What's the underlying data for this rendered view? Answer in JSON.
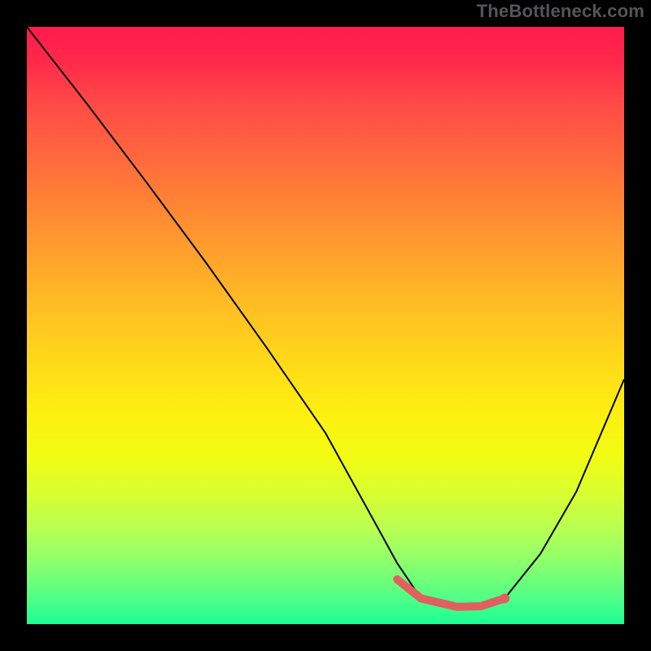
{
  "watermark": "TheBottleneck.com",
  "chart_data": {
    "type": "line",
    "title": "",
    "xlabel": "",
    "ylabel": "",
    "xlim": [
      0,
      100
    ],
    "ylim": [
      0,
      100
    ],
    "grid": false,
    "legend": false,
    "series": [
      {
        "name": "bottleneck-curve",
        "x": [
          0,
          10,
          20,
          30,
          40,
          50,
          58,
          62,
          66,
          72,
          76,
          80,
          86,
          92,
          100
        ],
        "values": [
          100,
          87.2,
          74.0,
          60.5,
          46.5,
          32.0,
          17.5,
          10.2,
          4.3,
          2.9,
          3.0,
          4.3,
          11.8,
          22.2,
          41.0
        ]
      },
      {
        "name": "highlight-band",
        "x": [
          62,
          66,
          72,
          76,
          80
        ],
        "values": [
          7.5,
          4.3,
          2.9,
          3.0,
          4.3
        ]
      }
    ],
    "gradient_stops": [
      {
        "pct": 0,
        "color": "#ff1a4d"
      },
      {
        "pct": 50,
        "color": "#ffd61a"
      },
      {
        "pct": 100,
        "color": "#1aff93"
      }
    ]
  }
}
